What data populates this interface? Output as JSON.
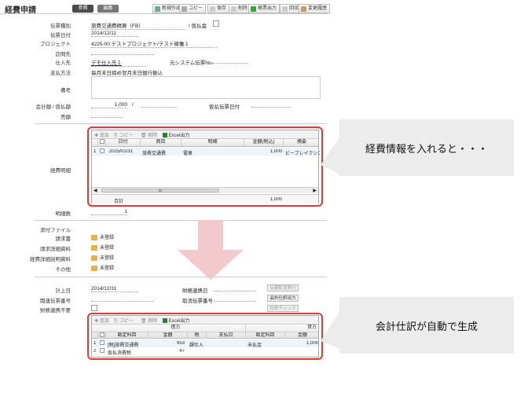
{
  "header": {
    "title": "経費申請",
    "mode_view": "参照",
    "mode_edit": "編集"
  },
  "toolbar": [
    {
      "label": "新規作成",
      "color": "#6a9"
    },
    {
      "label": "コピー",
      "color": "#aaa"
    },
    {
      "label": "保存",
      "color": "#ccc"
    },
    {
      "label": "削除",
      "color": "#ccc"
    },
    {
      "label": "帳票出力",
      "color": "#3a3"
    },
    {
      "label": "回収",
      "color": "#ccc"
    },
    {
      "label": "変更履歴",
      "color": "#c96"
    }
  ],
  "form": {
    "type_label": "伝票種別",
    "type_value": "旅費交通費精算（FB）",
    "provisional_label": "/ 仮払金",
    "date_label": "伝票日付",
    "date_value": "2014/12/11",
    "project_label": "プロジェクト",
    "project_value": "4225-00:テストプロジェクト/テスト稼働１",
    "visit_label": "訪問先",
    "vendor_label": "仕入先",
    "vendor_value": "デモ仕入先１",
    "orig_label": "元システム伝票No.",
    "payment_label": "支払方法",
    "payment_value": "毎月末日締め翌月末日銀行振込",
    "memo_label": "備考",
    "amount_label": "会計額 / 仮払額",
    "amount_value": "1,000",
    "slash": "/",
    "prov_date_label": "仮払伝票日付",
    "sales_label": "売額"
  },
  "expense": {
    "section_label": "経費明細",
    "tool_add": "追加",
    "tool_copy": "コピー",
    "tool_del": "削除",
    "tool_excel": "Excel出力",
    "columns": [
      "日付",
      "費目",
      "明細",
      "金額(税込)",
      "摘要"
    ],
    "rows": [
      {
        "num": "1",
        "date": "2015/01/31",
        "item": "旅費交通費",
        "detail": "電車",
        "amount": "1,000",
        "note": "ビーブレイクシステ"
      }
    ],
    "total_label": "合計",
    "total_value": "1,000",
    "scroll_mark": "III",
    "count_label": "明細数",
    "count_value": "1"
  },
  "attachments": {
    "title": "添付ファイル",
    "unregistered": "未登録",
    "items": [
      "請求書",
      "請求詳細資料",
      "経費詳細説明資料",
      "その他"
    ]
  },
  "accounting": {
    "posting_date_label": "計上日",
    "posting_date_value": "2014/12/31",
    "finance_link_label": "財務連携日",
    "related_label": "関連伝票番号",
    "cancel_label": "取消伝票番号",
    "finance_unneeded_label": "財務連携不要",
    "btn_cancel_exec": "伝票取消実行",
    "btn_journal_out": "会計仕訳出力",
    "btn_journal_check": "仕訳チェック"
  },
  "journal": {
    "tool_add": "追加",
    "tool_copy": "コピー",
    "tool_del": "削除",
    "tool_excel": "Excel出力",
    "debit_label": "借方",
    "credit_label": "貸方",
    "columns": [
      "勘定科目",
      "金額",
      "税",
      "支払日",
      "勘定科目",
      "金額"
    ],
    "rows": [
      {
        "num": "1",
        "acct": "[税]旅費交通費",
        "amount": "953",
        "tax": "課仕入",
        "date": "",
        "cacct": "未払金",
        "camount": "1,000"
      },
      {
        "num": "2",
        "acct": "仮払消費税",
        "amount": "47",
        "tax": "",
        "date": "",
        "cacct": "",
        "camount": ""
      }
    ]
  },
  "callouts": {
    "top": "経費情報を入れると・・・",
    "bottom": "会計仕訳が自動で生成"
  }
}
